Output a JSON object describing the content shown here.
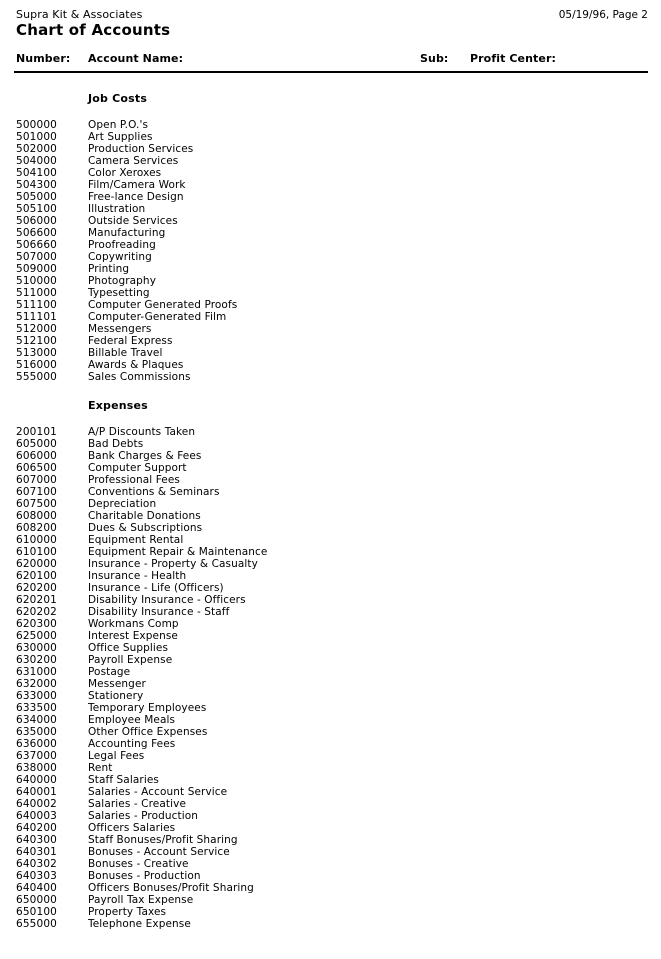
{
  "header": {
    "company": "Supra Kit & Associates",
    "title": "Chart of Accounts",
    "page_stamp": "05/19/96, Page 2"
  },
  "columns": {
    "number": "Number:",
    "account_name": "Account Name:",
    "sub": "Sub:",
    "profit_center": "Profit Center:"
  },
  "sections": [
    {
      "title": "Job Costs",
      "rows": [
        {
          "number": "500000",
          "name": "Open P.O.'s",
          "sub": "",
          "profit_center": ""
        },
        {
          "number": "501000",
          "name": "Art Supplies",
          "sub": "",
          "profit_center": ""
        },
        {
          "number": "502000",
          "name": "Production Services",
          "sub": "",
          "profit_center": ""
        },
        {
          "number": "504000",
          "name": "Camera Services",
          "sub": "",
          "profit_center": ""
        },
        {
          "number": "504100",
          "name": "Color Xeroxes",
          "sub": "",
          "profit_center": ""
        },
        {
          "number": "504300",
          "name": "Film/Camera Work",
          "sub": "",
          "profit_center": ""
        },
        {
          "number": "505000",
          "name": "Free-lance Design",
          "sub": "",
          "profit_center": ""
        },
        {
          "number": "505100",
          "name": "Illustration",
          "sub": "",
          "profit_center": ""
        },
        {
          "number": "506000",
          "name": "Outside Services",
          "sub": "",
          "profit_center": ""
        },
        {
          "number": "506600",
          "name": "Manufacturing",
          "sub": "",
          "profit_center": ""
        },
        {
          "number": "506660",
          "name": "Proofreading",
          "sub": "",
          "profit_center": ""
        },
        {
          "number": "507000",
          "name": "Copywriting",
          "sub": "",
          "profit_center": ""
        },
        {
          "number": "509000",
          "name": "Printing",
          "sub": "",
          "profit_center": ""
        },
        {
          "number": "510000",
          "name": "Photography",
          "sub": "",
          "profit_center": ""
        },
        {
          "number": "511000",
          "name": "Typesetting",
          "sub": "",
          "profit_center": ""
        },
        {
          "number": "511100",
          "name": "Computer Generated Proofs",
          "sub": "",
          "profit_center": ""
        },
        {
          "number": "511101",
          "name": "Computer-Generated Film",
          "sub": "",
          "profit_center": ""
        },
        {
          "number": "512000",
          "name": "Messengers",
          "sub": "",
          "profit_center": ""
        },
        {
          "number": "512100",
          "name": "Federal Express",
          "sub": "",
          "profit_center": ""
        },
        {
          "number": "513000",
          "name": "Billable Travel",
          "sub": "",
          "profit_center": ""
        },
        {
          "number": "516000",
          "name": "Awards & Plaques",
          "sub": "",
          "profit_center": ""
        },
        {
          "number": "555000",
          "name": "Sales Commissions",
          "sub": "",
          "profit_center": ""
        }
      ]
    },
    {
      "title": "Expenses",
      "rows": [
        {
          "number": "200101",
          "name": "A/P Discounts Taken",
          "sub": "",
          "profit_center": ""
        },
        {
          "number": "605000",
          "name": "Bad Debts",
          "sub": "",
          "profit_center": ""
        },
        {
          "number": "606000",
          "name": "Bank Charges & Fees",
          "sub": "",
          "profit_center": ""
        },
        {
          "number": "606500",
          "name": "Computer Support",
          "sub": "",
          "profit_center": ""
        },
        {
          "number": "607000",
          "name": "Professional Fees",
          "sub": "",
          "profit_center": ""
        },
        {
          "number": "607100",
          "name": "Conventions & Seminars",
          "sub": "",
          "profit_center": ""
        },
        {
          "number": "607500",
          "name": "Depreciation",
          "sub": "",
          "profit_center": ""
        },
        {
          "number": "608000",
          "name": "Charitable Donations",
          "sub": "",
          "profit_center": ""
        },
        {
          "number": "608200",
          "name": "Dues & Subscriptions",
          "sub": "",
          "profit_center": ""
        },
        {
          "number": "610000",
          "name": "Equipment Rental",
          "sub": "",
          "profit_center": ""
        },
        {
          "number": "610100",
          "name": "Equipment Repair & Maintenance",
          "sub": "",
          "profit_center": ""
        },
        {
          "number": "620000",
          "name": "Insurance  - Property & Casualty",
          "sub": "",
          "profit_center": ""
        },
        {
          "number": "620100",
          "name": "Insurance - Health",
          "sub": "",
          "profit_center": ""
        },
        {
          "number": "620200",
          "name": "Insurance - Life (Officers)",
          "sub": "",
          "profit_center": ""
        },
        {
          "number": "620201",
          "name": "Disability Insurance - Officers",
          "sub": "",
          "profit_center": ""
        },
        {
          "number": "620202",
          "name": "Disability Insurance - Staff",
          "sub": "",
          "profit_center": ""
        },
        {
          "number": "620300",
          "name": "Workmans Comp",
          "sub": "",
          "profit_center": ""
        },
        {
          "number": "625000",
          "name": "Interest Expense",
          "sub": "",
          "profit_center": ""
        },
        {
          "number": "630000",
          "name": "Office Supplies",
          "sub": "",
          "profit_center": ""
        },
        {
          "number": "630200",
          "name": "Payroll Expense",
          "sub": "",
          "profit_center": ""
        },
        {
          "number": "631000",
          "name": "Postage",
          "sub": "",
          "profit_center": ""
        },
        {
          "number": "632000",
          "name": "Messenger",
          "sub": "",
          "profit_center": ""
        },
        {
          "number": "633000",
          "name": "Stationery",
          "sub": "",
          "profit_center": ""
        },
        {
          "number": "633500",
          "name": "Temporary Employees",
          "sub": "",
          "profit_center": ""
        },
        {
          "number": "634000",
          "name": "Employee Meals",
          "sub": "",
          "profit_center": ""
        },
        {
          "number": "635000",
          "name": "Other Office Expenses",
          "sub": "",
          "profit_center": ""
        },
        {
          "number": "636000",
          "name": "Accounting Fees",
          "sub": "",
          "profit_center": ""
        },
        {
          "number": "637000",
          "name": "Legal Fees",
          "sub": "",
          "profit_center": ""
        },
        {
          "number": "638000",
          "name": "Rent",
          "sub": "",
          "profit_center": ""
        },
        {
          "number": "640000",
          "name": "Staff Salaries",
          "sub": "",
          "profit_center": ""
        },
        {
          "number": "640001",
          "name": "Salaries - Account Service",
          "sub": "",
          "profit_center": ""
        },
        {
          "number": "640002",
          "name": "Salaries - Creative",
          "sub": "",
          "profit_center": ""
        },
        {
          "number": "640003",
          "name": "Salaries - Production",
          "sub": "",
          "profit_center": ""
        },
        {
          "number": "640200",
          "name": "Officers Salaries",
          "sub": "",
          "profit_center": ""
        },
        {
          "number": "640300",
          "name": "Staff Bonuses/Profit Sharing",
          "sub": "",
          "profit_center": ""
        },
        {
          "number": "640301",
          "name": "Bonuses - Account Service",
          "sub": "",
          "profit_center": ""
        },
        {
          "number": "640302",
          "name": "Bonuses - Creative",
          "sub": "",
          "profit_center": ""
        },
        {
          "number": "640303",
          "name": "Bonuses - Production",
          "sub": "",
          "profit_center": ""
        },
        {
          "number": "640400",
          "name": "Officers Bonuses/Profit Sharing",
          "sub": "",
          "profit_center": ""
        },
        {
          "number": "650000",
          "name": "Payroll Tax Expense",
          "sub": "",
          "profit_center": ""
        },
        {
          "number": "650100",
          "name": "Property Taxes",
          "sub": "",
          "profit_center": ""
        },
        {
          "number": "655000",
          "name": "Telephone Expense",
          "sub": "",
          "profit_center": ""
        }
      ]
    }
  ]
}
